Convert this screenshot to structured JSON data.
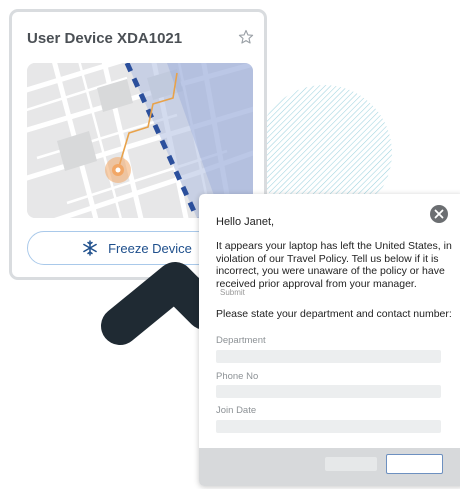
{
  "device_card": {
    "title": "User Device XDA1021",
    "freeze_label": "Freeze Device"
  },
  "dialog": {
    "greeting": "Hello Janet,",
    "message": "It appears your laptop has left the United States, in violation of our Travel Policy. Tell us below if it is incorrect, you were unaware of the policy or have received prior approval from your manager.",
    "prompt": "Please state your department and contact number:",
    "fields": [
      {
        "label": "Department",
        "value": ""
      },
      {
        "label": "Phone No",
        "value": ""
      },
      {
        "label": "Join Date",
        "value": ""
      }
    ],
    "submit_label": "Submit"
  },
  "colors": {
    "brand_blue": "#1e4f8c",
    "border_blue": "#6d90c0",
    "location_marker": "#f2a766",
    "route": "#e8a24a"
  },
  "icons": [
    "star-icon",
    "snowflake-icon",
    "close-icon",
    "location-marker-icon"
  ]
}
